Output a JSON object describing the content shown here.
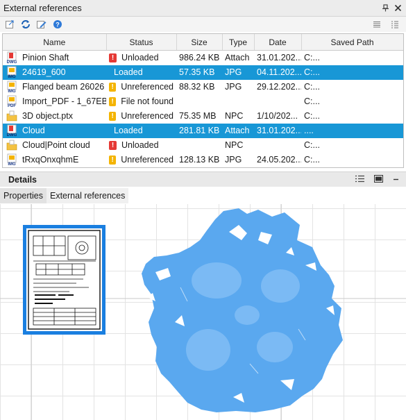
{
  "panel": {
    "title": "External references"
  },
  "columns": {
    "name": "Name",
    "status": "Status",
    "size": "Size",
    "type": "Type",
    "date": "Date",
    "saved_path": "Saved Path"
  },
  "rows": [
    {
      "name": "Pinion Shaft",
      "icon": "dwg-file-icon",
      "icon_text": "DWG",
      "status": "Unloaded",
      "status_icon": "error-icon",
      "size": "986.24 KB",
      "type": "Attach",
      "date": "31.01.202...",
      "path": "C:...",
      "selected": false
    },
    {
      "name": "24619_600",
      "icon": "img-file-icon",
      "icon_text": "IMG",
      "status": "Loaded",
      "status_icon": "",
      "size": "57.35 KB",
      "type": "JPG",
      "date": "04.11.202...",
      "path": "C:...",
      "selected": true
    },
    {
      "name": "Flanged beam 26026",
      "icon": "img-file-icon",
      "icon_text": "IMG",
      "status": "Unreferenced",
      "status_icon": "warning-icon",
      "size": "88.32 KB",
      "type": "JPG",
      "date": "29.12.202...",
      "path": "C:...",
      "selected": false
    },
    {
      "name": "Import_PDF - 1_67EB",
      "icon": "pdf-file-icon",
      "icon_text": "PDF",
      "status": "File not found",
      "status_icon": "warning-icon",
      "size": "",
      "type": "",
      "date": "",
      "path": "C:...",
      "selected": false
    },
    {
      "name": "3D object.ptx",
      "icon": "point-cloud-icon",
      "icon_text": "",
      "status": "Unreferenced",
      "status_icon": "warning-icon",
      "size": "75.35 MB",
      "type": "NPC",
      "date": "1/10/202...",
      "path": "C:...",
      "selected": false
    },
    {
      "name": "Cloud",
      "icon": "dwg-file-icon",
      "icon_text": "DWG",
      "status": "Loaded",
      "status_icon": "",
      "size": "281.81 KB",
      "type": "Attach",
      "date": "31.01.202...",
      "path": "....",
      "selected": true
    },
    {
      "name": "Cloud|Point cloud",
      "icon": "point-cloud-icon",
      "icon_text": "",
      "status": "Unloaded",
      "status_icon": "error-icon",
      "size": "",
      "type": "NPC",
      "date": "",
      "path": "C:...",
      "selected": false
    },
    {
      "name": "tRxqOnxqhmE",
      "icon": "img-file-icon",
      "icon_text": "IMG",
      "status": "Unreferenced",
      "status_icon": "warning-icon",
      "size": "128.13 KB",
      "type": "JPG",
      "date": "24.05.202...",
      "path": "C:...",
      "selected": false
    }
  ],
  "details": {
    "title": "Details"
  },
  "tabs": [
    {
      "label": "Properties",
      "active": false
    },
    {
      "label": "External references",
      "active": true
    }
  ],
  "colors": {
    "selection": "#1897d6",
    "error": "#e53935",
    "warning": "#f4b400",
    "cloud": "#5aa8ef",
    "frame": "#1a7fe0"
  }
}
